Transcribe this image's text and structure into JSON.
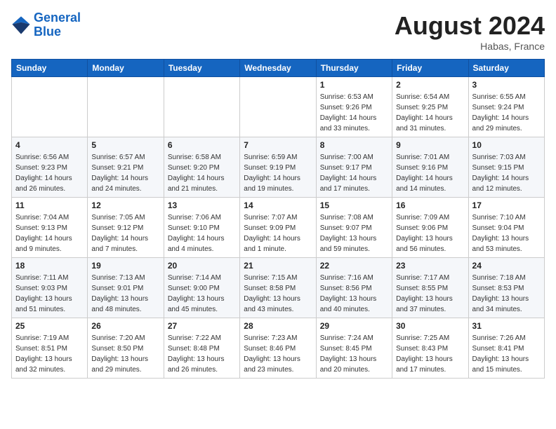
{
  "logo": {
    "line1": "General",
    "line2": "Blue"
  },
  "title": "August 2024",
  "location": "Habas, France",
  "days_of_week": [
    "Sunday",
    "Monday",
    "Tuesday",
    "Wednesday",
    "Thursday",
    "Friday",
    "Saturday"
  ],
  "weeks": [
    [
      {
        "day": "",
        "info": ""
      },
      {
        "day": "",
        "info": ""
      },
      {
        "day": "",
        "info": ""
      },
      {
        "day": "",
        "info": ""
      },
      {
        "day": "1",
        "info": "Sunrise: 6:53 AM\nSunset: 9:26 PM\nDaylight: 14 hours\nand 33 minutes."
      },
      {
        "day": "2",
        "info": "Sunrise: 6:54 AM\nSunset: 9:25 PM\nDaylight: 14 hours\nand 31 minutes."
      },
      {
        "day": "3",
        "info": "Sunrise: 6:55 AM\nSunset: 9:24 PM\nDaylight: 14 hours\nand 29 minutes."
      }
    ],
    [
      {
        "day": "4",
        "info": "Sunrise: 6:56 AM\nSunset: 9:23 PM\nDaylight: 14 hours\nand 26 minutes."
      },
      {
        "day": "5",
        "info": "Sunrise: 6:57 AM\nSunset: 9:21 PM\nDaylight: 14 hours\nand 24 minutes."
      },
      {
        "day": "6",
        "info": "Sunrise: 6:58 AM\nSunset: 9:20 PM\nDaylight: 14 hours\nand 21 minutes."
      },
      {
        "day": "7",
        "info": "Sunrise: 6:59 AM\nSunset: 9:19 PM\nDaylight: 14 hours\nand 19 minutes."
      },
      {
        "day": "8",
        "info": "Sunrise: 7:00 AM\nSunset: 9:17 PM\nDaylight: 14 hours\nand 17 minutes."
      },
      {
        "day": "9",
        "info": "Sunrise: 7:01 AM\nSunset: 9:16 PM\nDaylight: 14 hours\nand 14 minutes."
      },
      {
        "day": "10",
        "info": "Sunrise: 7:03 AM\nSunset: 9:15 PM\nDaylight: 14 hours\nand 12 minutes."
      }
    ],
    [
      {
        "day": "11",
        "info": "Sunrise: 7:04 AM\nSunset: 9:13 PM\nDaylight: 14 hours\nand 9 minutes."
      },
      {
        "day": "12",
        "info": "Sunrise: 7:05 AM\nSunset: 9:12 PM\nDaylight: 14 hours\nand 7 minutes."
      },
      {
        "day": "13",
        "info": "Sunrise: 7:06 AM\nSunset: 9:10 PM\nDaylight: 14 hours\nand 4 minutes."
      },
      {
        "day": "14",
        "info": "Sunrise: 7:07 AM\nSunset: 9:09 PM\nDaylight: 14 hours\nand 1 minute."
      },
      {
        "day": "15",
        "info": "Sunrise: 7:08 AM\nSunset: 9:07 PM\nDaylight: 13 hours\nand 59 minutes."
      },
      {
        "day": "16",
        "info": "Sunrise: 7:09 AM\nSunset: 9:06 PM\nDaylight: 13 hours\nand 56 minutes."
      },
      {
        "day": "17",
        "info": "Sunrise: 7:10 AM\nSunset: 9:04 PM\nDaylight: 13 hours\nand 53 minutes."
      }
    ],
    [
      {
        "day": "18",
        "info": "Sunrise: 7:11 AM\nSunset: 9:03 PM\nDaylight: 13 hours\nand 51 minutes."
      },
      {
        "day": "19",
        "info": "Sunrise: 7:13 AM\nSunset: 9:01 PM\nDaylight: 13 hours\nand 48 minutes."
      },
      {
        "day": "20",
        "info": "Sunrise: 7:14 AM\nSunset: 9:00 PM\nDaylight: 13 hours\nand 45 minutes."
      },
      {
        "day": "21",
        "info": "Sunrise: 7:15 AM\nSunset: 8:58 PM\nDaylight: 13 hours\nand 43 minutes."
      },
      {
        "day": "22",
        "info": "Sunrise: 7:16 AM\nSunset: 8:56 PM\nDaylight: 13 hours\nand 40 minutes."
      },
      {
        "day": "23",
        "info": "Sunrise: 7:17 AM\nSunset: 8:55 PM\nDaylight: 13 hours\nand 37 minutes."
      },
      {
        "day": "24",
        "info": "Sunrise: 7:18 AM\nSunset: 8:53 PM\nDaylight: 13 hours\nand 34 minutes."
      }
    ],
    [
      {
        "day": "25",
        "info": "Sunrise: 7:19 AM\nSunset: 8:51 PM\nDaylight: 13 hours\nand 32 minutes."
      },
      {
        "day": "26",
        "info": "Sunrise: 7:20 AM\nSunset: 8:50 PM\nDaylight: 13 hours\nand 29 minutes."
      },
      {
        "day": "27",
        "info": "Sunrise: 7:22 AM\nSunset: 8:48 PM\nDaylight: 13 hours\nand 26 minutes."
      },
      {
        "day": "28",
        "info": "Sunrise: 7:23 AM\nSunset: 8:46 PM\nDaylight: 13 hours\nand 23 minutes."
      },
      {
        "day": "29",
        "info": "Sunrise: 7:24 AM\nSunset: 8:45 PM\nDaylight: 13 hours\nand 20 minutes."
      },
      {
        "day": "30",
        "info": "Sunrise: 7:25 AM\nSunset: 8:43 PM\nDaylight: 13 hours\nand 17 minutes."
      },
      {
        "day": "31",
        "info": "Sunrise: 7:26 AM\nSunset: 8:41 PM\nDaylight: 13 hours\nand 15 minutes."
      }
    ]
  ]
}
